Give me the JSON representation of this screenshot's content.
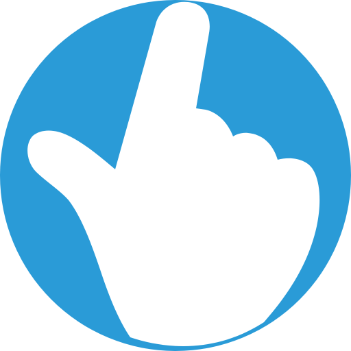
{
  "icon": {
    "name": "pointing-hand-icon",
    "background_color": "#2A9BD7",
    "foreground_color": "#FFFFFF",
    "shape": "circle"
  }
}
